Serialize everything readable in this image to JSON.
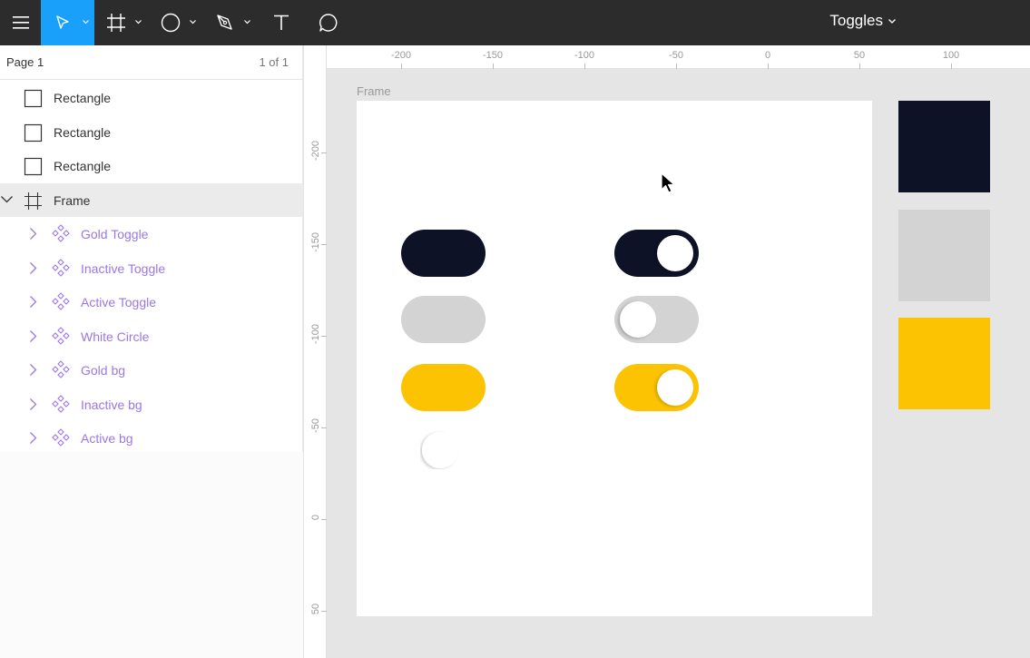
{
  "toolbar": {
    "doc_title": "Toggles",
    "icons": [
      "menu-icon",
      "move-icon",
      "frame-icon",
      "ellipse-icon",
      "pen-icon",
      "text-icon",
      "comment-icon"
    ],
    "accent": "#18a0fb"
  },
  "pages": {
    "current": "Page 1",
    "count": "1 of 1"
  },
  "layers": [
    {
      "label": "Rectangle",
      "kind": "rectangle"
    },
    {
      "label": "Rectangle",
      "kind": "rectangle"
    },
    {
      "label": "Rectangle",
      "kind": "rectangle"
    },
    {
      "label": "Frame",
      "kind": "frame",
      "selected": true,
      "expanded": true
    },
    {
      "label": "Gold Toggle",
      "kind": "component"
    },
    {
      "label": "Inactive Toggle",
      "kind": "component"
    },
    {
      "label": "Active Toggle",
      "kind": "component"
    },
    {
      "label": "White Circle",
      "kind": "component"
    },
    {
      "label": "Gold bg",
      "kind": "component"
    },
    {
      "label": "Inactive bg",
      "kind": "component"
    },
    {
      "label": "Active bg",
      "kind": "component"
    }
  ],
  "ruler": {
    "horizontal": [
      "-200",
      "-150",
      "-100",
      "-50",
      "0",
      "50",
      "100"
    ],
    "vertical": [
      "-200",
      "-150",
      "-100",
      "-50",
      "0",
      "50"
    ]
  },
  "canvas": {
    "frame_label": "Frame",
    "colors": {
      "dark": "#0e1226",
      "gray": "#d3d3d3",
      "gold": "#fcc302",
      "white": "#ffffff",
      "component": "#9b77e3"
    }
  }
}
